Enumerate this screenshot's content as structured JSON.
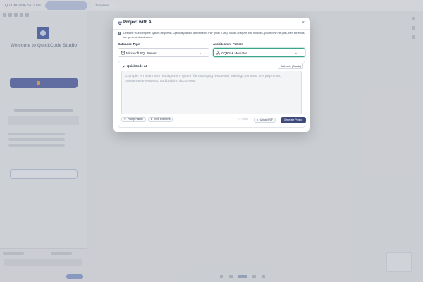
{
  "modal": {
    "title": "Project with AI",
    "close_icon": "×",
    "info_text": "Describe your complete system (required). Optionally attach a text-based PDF (max 5 MB). Studio analyzes into modules, you review the plan, then schemas are generated and saved.",
    "database": {
      "label": "Database Type",
      "value": "Microsoft SQL Server",
      "icon": "database-icon"
    },
    "architecture": {
      "label": "Architecture Pattern",
      "value": "CQRS & Mediator",
      "icon": "network-icon"
    },
    "quickcode": {
      "label": "QuickCode AI",
      "provider": "Anthropic (Claude)",
      "placeholder": "Example: An apartment management system for managing residential buildings, tenants, rent payments, maintenance requests, and building documents",
      "prompt_history": "Prompt History",
      "view_examples": "View Examples",
      "counter": "77 / 2000",
      "upload_pdf": "Upload PDF",
      "generate": "Generate Project"
    }
  },
  "background": {
    "brand_name": "QUICKCODE STUDIO",
    "welcome": "Welcome to QuickCode Studio",
    "tab_label": "Templates"
  },
  "colors": {
    "primary": "#3e4a7c",
    "accent_focus": "#3aa58a"
  }
}
